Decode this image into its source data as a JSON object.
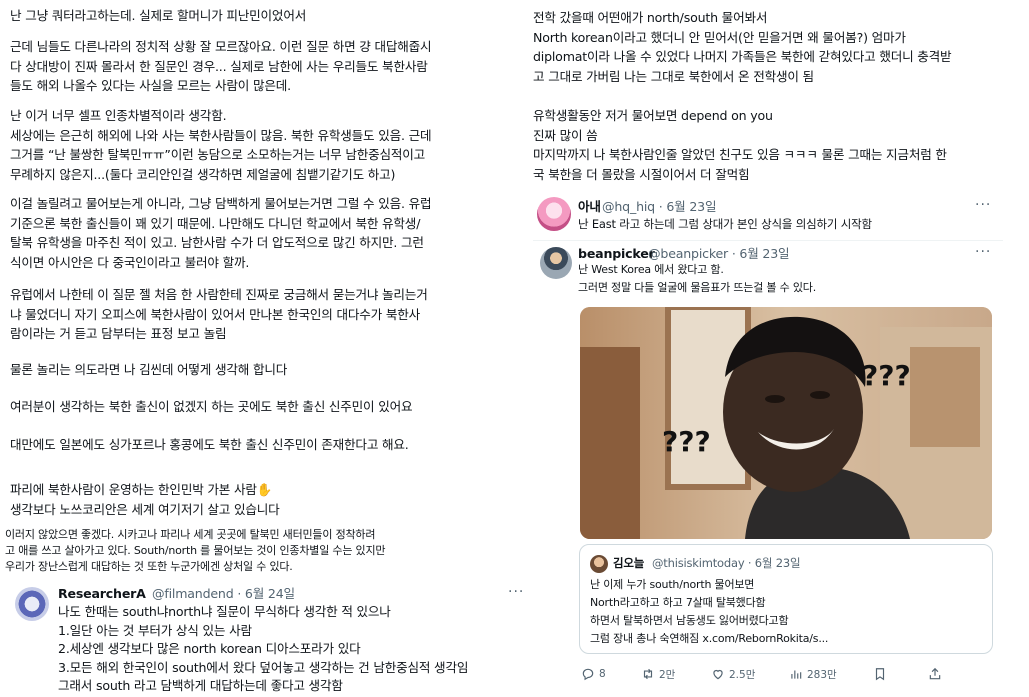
{
  "left": {
    "p1": [
      "난 그냥 쿼터라고하는데. 실제로 할머니가 피난민이었어서"
    ],
    "p2": [
      "근데 님들도 다른나라의 정치적 상황 잘 모르잖아요. 이런 질문 하면 걍 대답해줍시",
      "다 상대방이 진짜 몰라서 한 질문인 경우... 실제로 남한에 사는 우리들도 북한사람",
      "들도 해외 나올수 있다는 사실을 모르는 사람이 많은데."
    ],
    "p3": [
      "난 이거 너무 셀프 인종차별적이라 생각함.",
      "세상에는 은근히 해외에 나와 사는 북한사람들이 많음. 북한 유학생들도 있음. 근데",
      "그거를 “난 불쌍한 탈북민ㅠㅠ”이런 농담으로 소모하는거는 너무 남한중심적이고",
      "무례하지 않은지...(둘다 코리안인걸 생각하면 제얼굴에 침뱉기같기도 하고)"
    ],
    "p4": [
      "이걸 놀릴려고 물어보는게 아니라, 그냥 담백하게 물어보는거면 그럴 수 있음. 유럽",
      "기준으론 북한 출신들이 꽤 있기 때문에. 나만해도 다니던 학교에서 북한 유학생/",
      "탈북 유학생을 마주친 적이 있고. 남한사람 수가 더 압도적으로 많긴 하지만. 그런",
      "식이면 아시안은 다 중국인이라고 불러야 할까."
    ],
    "p5": [
      "유럽에서 나한테 이 질문 젤 처음 한 사람한테 진짜로 궁금해서 묻는거냐 놀리는거",
      "냐 물었더니 자기 오피스에 북한사람이 있어서 만나본 한국인의 대다수가 북한사",
      "람이라는 거 듣고 담부터는 표정 보고 놀림"
    ],
    "p6": [
      "물론 놀리는 의도라면 나 김씬데 어떻게 생각해 합니다"
    ],
    "p7": [
      "여러분이 생각하는 북한 출신이 없겠지 하는 곳에도 북한 출신 신주민이 있어요"
    ],
    "p8": [
      "대만에도 일본에도 싱가포르나 홍콩에도 북한 출신 신주민이 존재한다고 해요."
    ],
    "p9": [
      "파리에 북한사람이 운영하는 한인민박 가본 사람✋",
      "생각보다 노쓰코리안은 세계 여기저기 살고 있습니다"
    ],
    "p10": [
      "이러지 않았으면 좋겠다. 시카고나 파리나 세계 곳곳에 탈북민 새터민들이 정착하려",
      "고 애를 쓰고 살아가고 있다.  South/north 를 물어보는 것이 인종차별일 수는 있지만",
      "우리가 장난스럽게 대답하는 것 또한 누군가에겐 상처일 수 있다."
    ],
    "researcher": {
      "name": "ResearcherA",
      "meta": "@filmandend · 6월 24일",
      "more": "···",
      "lines": [
        "나도 한때는 south냐north냐 질문이 무식하다 생각한 적 있으나",
        "1.일단 아는 것 부터가 상식 있는 사람",
        "2.세상엔 생각보다 많은 north korean 디아스포라가 있다",
        "3.모든 해외 한국인이 south에서 왔다 덮어놓고 생각하는 건 남한중심적 생각임",
        "그래서 south 라고 담백하게 대답하는데 좋다고 생각함"
      ]
    }
  },
  "right": {
    "r1": [
      "전학 갔을때 어떤애가 north/south 물어봐서",
      "North korean이라고 했더니 안 믿어서(안 믿을거면 왜 물어봄?) 엄마가",
      "diplomat이라 나올 수 있었다 나머지 가족들은 북한에 갇혀있다고 했더니 충격받",
      "고 그대로 가버림 나는 그대로 북한에서 온 전학생이 됨"
    ],
    "r2": [
      "유학생활동안 저거 물어보면 depend on you",
      "진짜 많이 씀",
      "마지막까지 나 북한사람인줄 알았던 친구도 있음 ㅋㅋㅋ 물론 그때는 지금처럼 한",
      "국 북한을 더 몰랐을 시절이어서 더 잘먹힘"
    ],
    "anae": {
      "name": "아내",
      "meta": "@hq_hiq · 6월 23일",
      "more": "···",
      "text": "난 East 라고 하는데 그럼 상대가 본인 상식을 의심하기 시작함"
    },
    "bean": {
      "name": "beanpicker",
      "meta": "@beanpicker · 6월 23일",
      "more": "···",
      "lines": [
        "난 West Korea 에서 왔다고 함.",
        "그러면 정말 다들 얼굴에 물음표가 뜨는걸 볼 수 있다."
      ]
    },
    "meme": {
      "left_text": "???",
      "right_text": "???"
    },
    "quote": {
      "name": "김오늘",
      "meta": "@thisiskimtoday · 6월 23일",
      "lines": [
        "난 이제 누가 south/north 물어보면",
        "North라고하고 하고 7살때 탈북했다함",
        "하면서 탈북하면서 남동생도 잃어버렸다고함",
        "그럼 장내 총나 숙연해짐 x.com/RebornRokita/s..."
      ]
    },
    "actions": {
      "reply": "8",
      "retweet": "2만",
      "like": "2.5만",
      "views": "283만"
    }
  }
}
